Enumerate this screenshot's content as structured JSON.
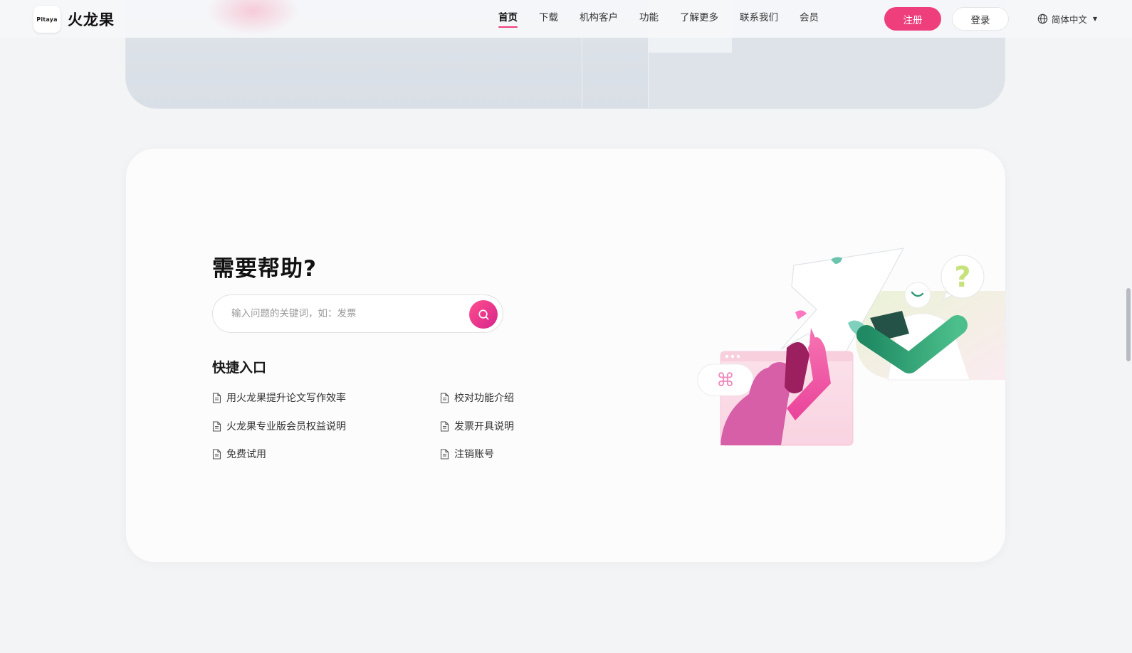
{
  "header": {
    "logo_text": "Pitaya",
    "brand_name": "火龙果",
    "nav": [
      {
        "label": "首页",
        "active": true
      },
      {
        "label": "下载",
        "active": false
      },
      {
        "label": "机构客户",
        "active": false
      },
      {
        "label": "功能",
        "active": false
      },
      {
        "label": "了解更多",
        "active": false
      },
      {
        "label": "联系我们",
        "active": false
      },
      {
        "label": "会员",
        "active": false
      }
    ],
    "register_label": "注册",
    "login_label": "登录",
    "language_label": "简体中文"
  },
  "help": {
    "title": "需要帮助?",
    "search_placeholder": "输入问题的关键词，如：发票",
    "quick_title": "快捷入口",
    "links": [
      "用火龙果提升论文写作效率",
      "校对功能介绍",
      "火龙果专业版会员权益说明",
      "发票开具说明",
      "免费试用",
      "注销账号"
    ]
  },
  "icons": {
    "search": "search-icon",
    "language": "globe-icon",
    "doc": "document-icon",
    "caret": "caret-down-icon"
  },
  "colors": {
    "accent": "#ee3f7c",
    "page_bg": "#f3f4f6",
    "card_bg": "#fcfcfd",
    "green": "#2f9a75"
  }
}
